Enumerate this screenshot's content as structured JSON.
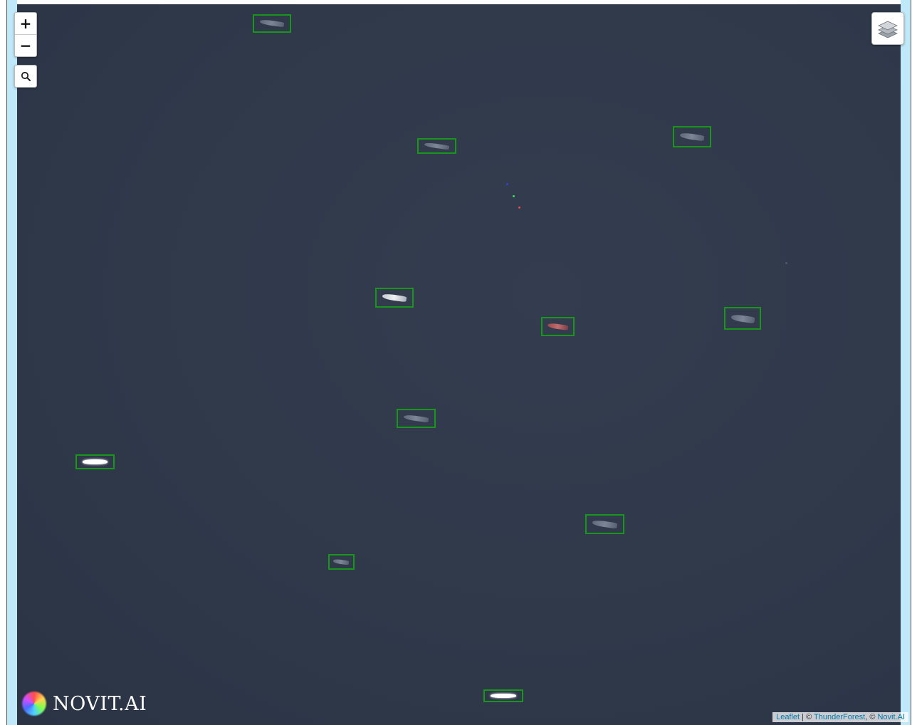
{
  "controls": {
    "zoom_in": "+",
    "zoom_out": "−"
  },
  "icons": {
    "search": "search-icon",
    "layers": "layers-icon"
  },
  "colors": {
    "detection_box": "#17961b",
    "sea": "#2f394a"
  },
  "detections": [
    {
      "hull": "dark"
    },
    {
      "hull": "dark"
    },
    {
      "hull": "dark"
    },
    {
      "hull": "light"
    },
    {
      "hull": "red"
    },
    {
      "hull": "dark"
    },
    {
      "hull": "dark"
    },
    {
      "hull": "white"
    },
    {
      "hull": "dark"
    },
    {
      "hull": "dark"
    },
    {
      "hull": "white"
    }
  ],
  "logo": {
    "text": "NOVIT.AI"
  },
  "attribution": {
    "leaflet": "Leaflet",
    "separator": " | © ",
    "thunderforest": "ThunderForest",
    "comma": ", © ",
    "novit": "Novit.AI"
  }
}
